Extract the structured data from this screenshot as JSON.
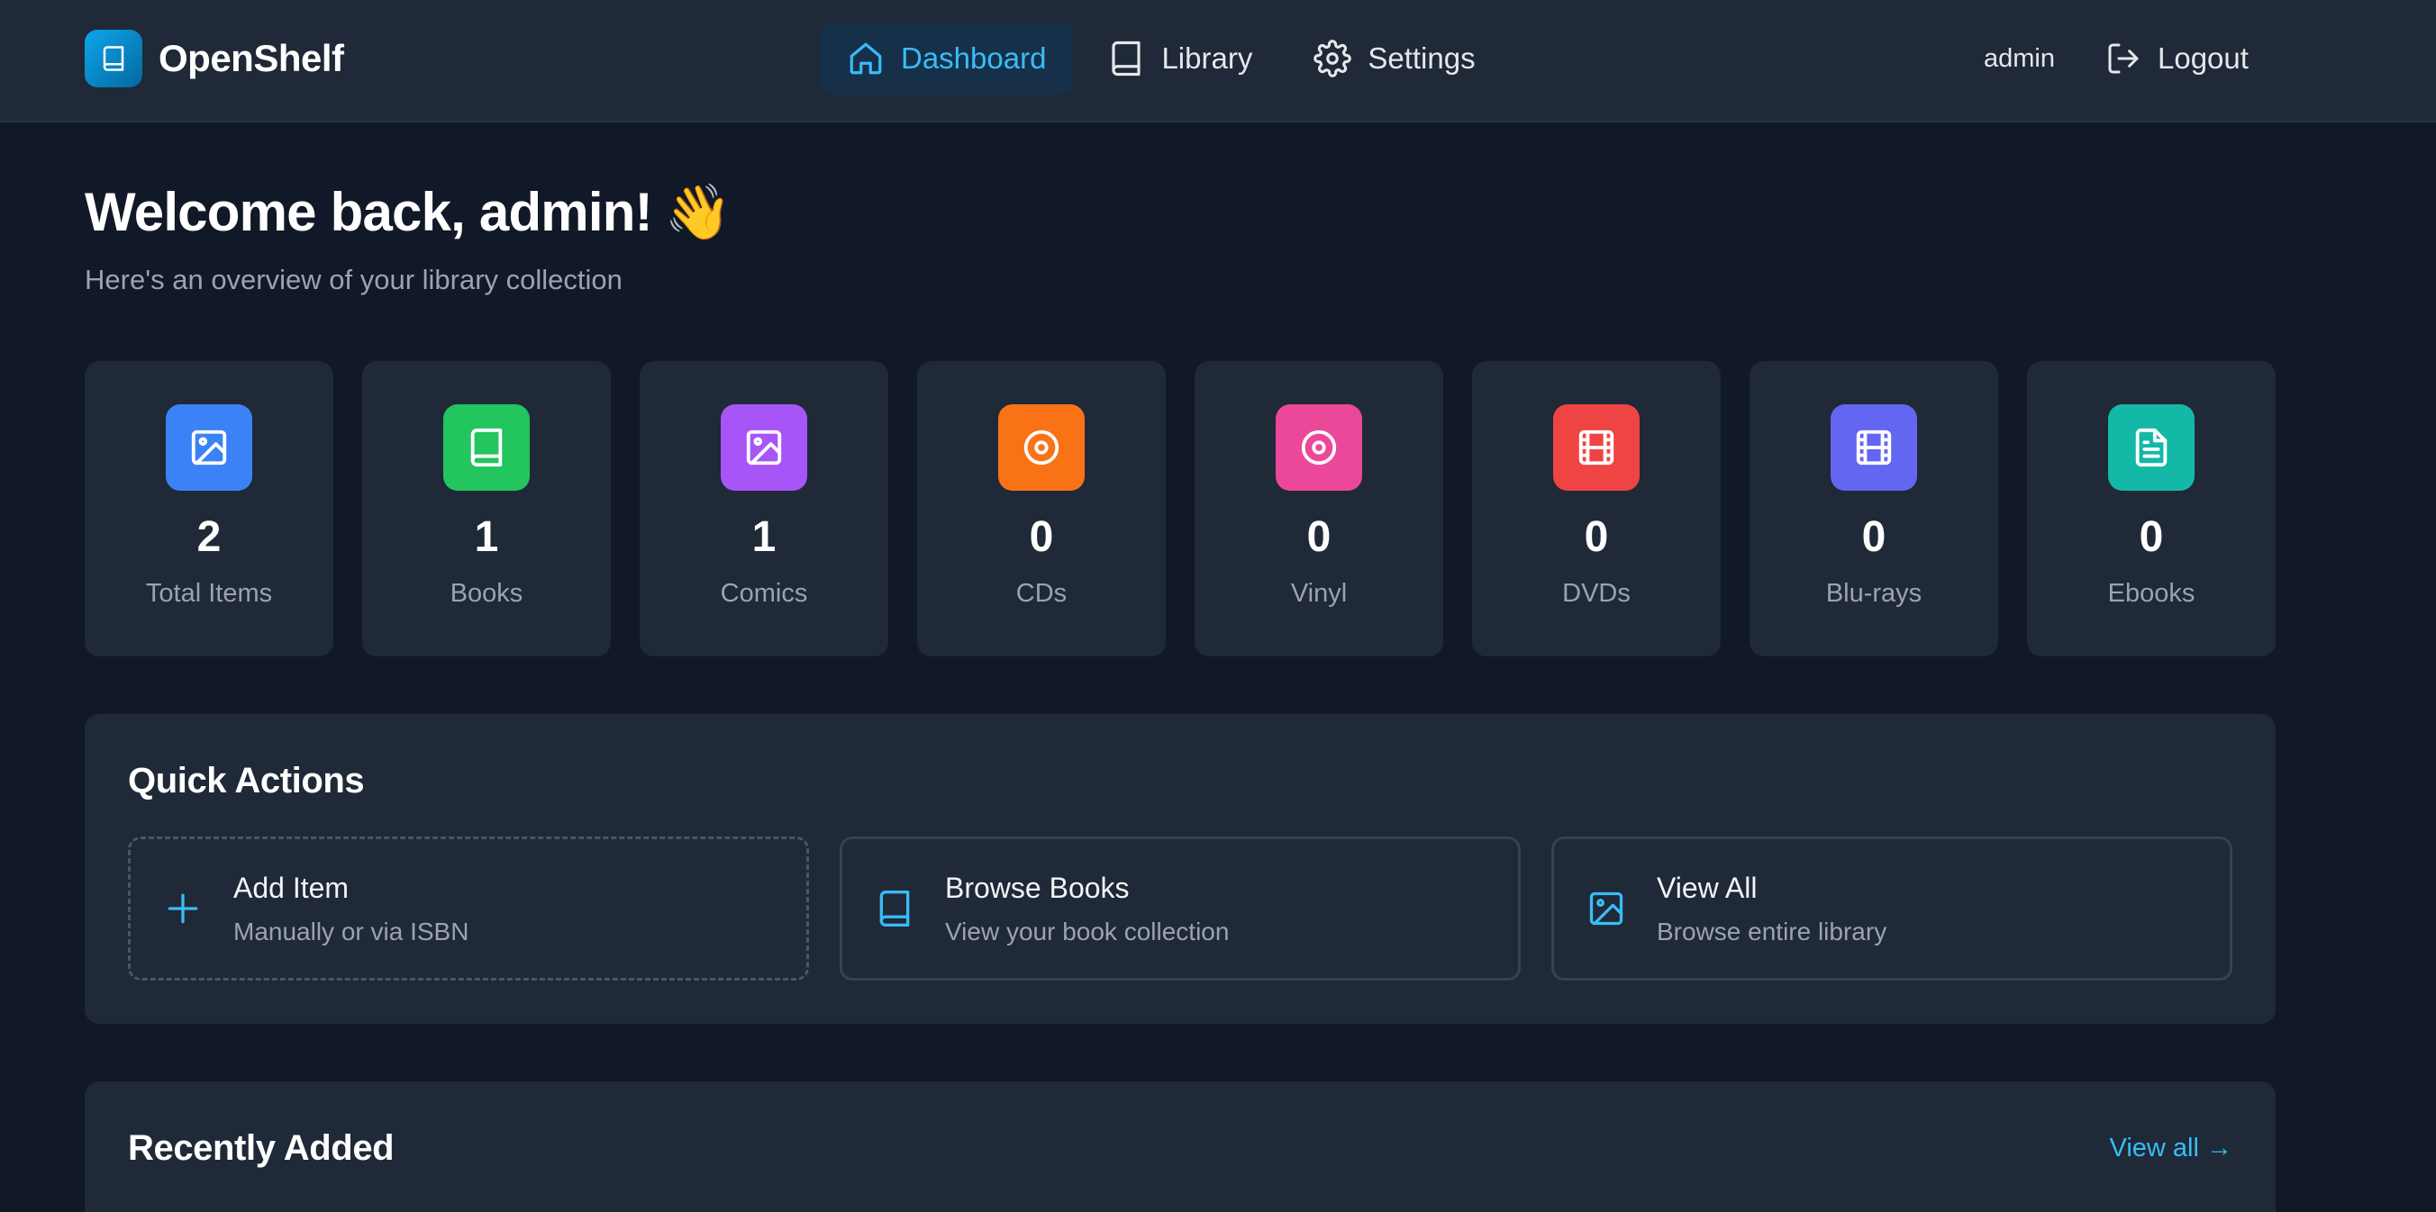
{
  "app": {
    "name": "OpenShelf"
  },
  "nav": {
    "items": [
      {
        "label": "Dashboard",
        "icon": "home-icon",
        "active": true
      },
      {
        "label": "Library",
        "icon": "book-icon",
        "active": false
      },
      {
        "label": "Settings",
        "icon": "gear-icon",
        "active": false
      }
    ]
  },
  "user": {
    "name": "admin",
    "logout_label": "Logout"
  },
  "welcome": {
    "title": "Welcome back, admin!",
    "emoji": "👋",
    "subtitle": "Here's an overview of your library collection"
  },
  "stats": [
    {
      "value": "2",
      "label": "Total Items",
      "icon": "image-icon",
      "color": "#3b82f6"
    },
    {
      "value": "1",
      "label": "Books",
      "icon": "book-icon",
      "color": "#22c55e"
    },
    {
      "value": "1",
      "label": "Comics",
      "icon": "image-icon",
      "color": "#a855f7"
    },
    {
      "value": "0",
      "label": "CDs",
      "icon": "disc-icon",
      "color": "#f97316"
    },
    {
      "value": "0",
      "label": "Vinyl",
      "icon": "disc-icon",
      "color": "#ec4899"
    },
    {
      "value": "0",
      "label": "DVDs",
      "icon": "film-icon",
      "color": "#ef4444"
    },
    {
      "value": "0",
      "label": "Blu-rays",
      "icon": "film-icon",
      "color": "#6366f1"
    },
    {
      "value": "0",
      "label": "Ebooks",
      "icon": "file-text-icon",
      "color": "#14b8a6"
    }
  ],
  "quick_actions": {
    "title": "Quick Actions",
    "items": [
      {
        "title": "Add Item",
        "subtitle": "Manually or via ISBN",
        "icon": "plus-icon"
      },
      {
        "title": "Browse Books",
        "subtitle": "View your book collection",
        "icon": "book-icon"
      },
      {
        "title": "View All",
        "subtitle": "Browse entire library",
        "icon": "image-icon"
      }
    ]
  },
  "recently_added": {
    "title": "Recently Added",
    "view_all_label": "View all →"
  },
  "colors": {
    "accent": "#38bdf8",
    "background": "#111827",
    "card": "#1f2937"
  }
}
